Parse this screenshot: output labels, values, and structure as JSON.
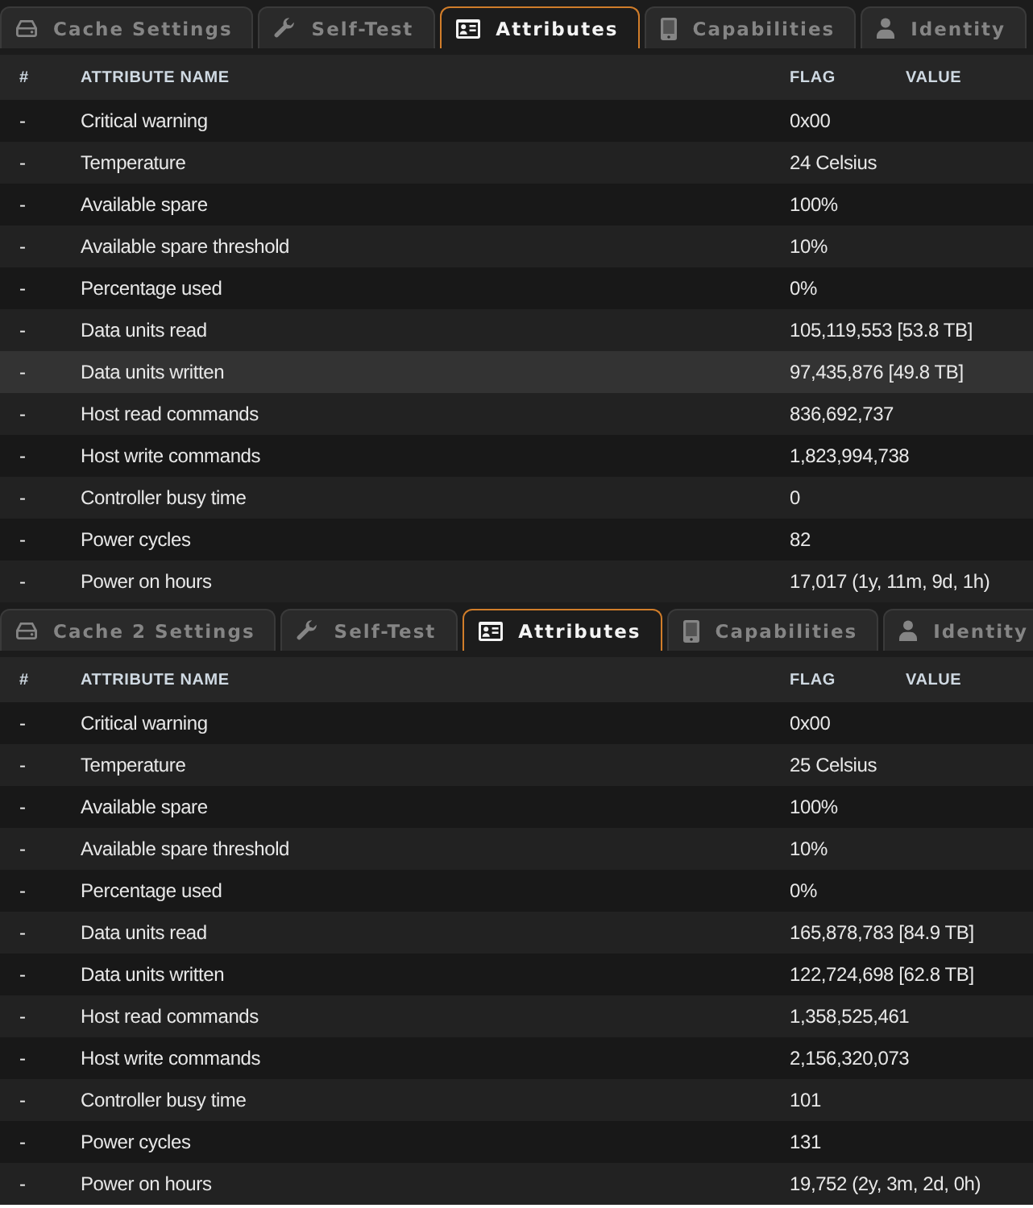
{
  "panels": [
    {
      "tabs": [
        {
          "label": "Cache Settings",
          "selected": false
        },
        {
          "label": "Self-Test",
          "selected": false
        },
        {
          "label": "Attributes",
          "selected": true
        },
        {
          "label": "Capabilities",
          "selected": false
        },
        {
          "label": "Identity",
          "selected": false
        }
      ],
      "columns": [
        "#",
        "ATTRIBUTE NAME",
        "FLAG",
        "VALUE"
      ],
      "rows": [
        {
          "number": "-",
          "name": "Critical warning",
          "value": "0x00",
          "selected": false
        },
        {
          "number": "-",
          "name": "Temperature",
          "value": "24 Celsius",
          "selected": false
        },
        {
          "number": "-",
          "name": "Available spare",
          "value": "100%",
          "selected": false
        },
        {
          "number": "-",
          "name": "Available spare threshold",
          "value": "10%",
          "selected": false
        },
        {
          "number": "-",
          "name": "Percentage used",
          "value": "0%",
          "selected": false
        },
        {
          "number": "-",
          "name": "Data units read",
          "value": "105,119,553 [53.8 TB]",
          "selected": false
        },
        {
          "number": "-",
          "name": "Data units written",
          "value": "97,435,876 [49.8 TB]",
          "selected": true
        },
        {
          "number": "-",
          "name": "Host read commands",
          "value": "836,692,737",
          "selected": false
        },
        {
          "number": "-",
          "name": "Host write commands",
          "value": "1,823,994,738",
          "selected": false
        },
        {
          "number": "-",
          "name": "Controller busy time",
          "value": "0",
          "selected": false
        },
        {
          "number": "-",
          "name": "Power cycles",
          "value": "82",
          "selected": false
        },
        {
          "number": "-",
          "name": "Power on hours",
          "value": "17,017 (1y, 11m, 9d, 1h)",
          "selected": false
        }
      ]
    },
    {
      "tabs": [
        {
          "label": "Cache 2 Settings",
          "selected": false
        },
        {
          "label": "Self-Test",
          "selected": false
        },
        {
          "label": "Attributes",
          "selected": true
        },
        {
          "label": "Capabilities",
          "selected": false
        },
        {
          "label": "Identity",
          "selected": false
        }
      ],
      "columns": [
        "#",
        "ATTRIBUTE NAME",
        "FLAG",
        "VALUE"
      ],
      "rows": [
        {
          "number": "-",
          "name": "Critical warning",
          "value": "0x00",
          "selected": false
        },
        {
          "number": "-",
          "name": "Temperature",
          "value": "25 Celsius",
          "selected": false
        },
        {
          "number": "-",
          "name": "Available spare",
          "value": "100%",
          "selected": false
        },
        {
          "number": "-",
          "name": "Available spare threshold",
          "value": "10%",
          "selected": false
        },
        {
          "number": "-",
          "name": "Percentage used",
          "value": "0%",
          "selected": false
        },
        {
          "number": "-",
          "name": "Data units read",
          "value": "165,878,783 [84.9 TB]",
          "selected": false
        },
        {
          "number": "-",
          "name": "Data units written",
          "value": "122,724,698 [62.8 TB]",
          "selected": false
        },
        {
          "number": "-",
          "name": "Host read commands",
          "value": "1,358,525,461",
          "selected": false
        },
        {
          "number": "-",
          "name": "Host write commands",
          "value": "2,156,320,073",
          "selected": false
        },
        {
          "number": "-",
          "name": "Controller busy time",
          "value": "101",
          "selected": false
        },
        {
          "number": "-",
          "name": "Power cycles",
          "value": "131",
          "selected": false
        },
        {
          "number": "-",
          "name": "Power on hours",
          "value": "19,752 (2y, 3m, 2d, 0h)",
          "selected": false
        }
      ]
    }
  ]
}
